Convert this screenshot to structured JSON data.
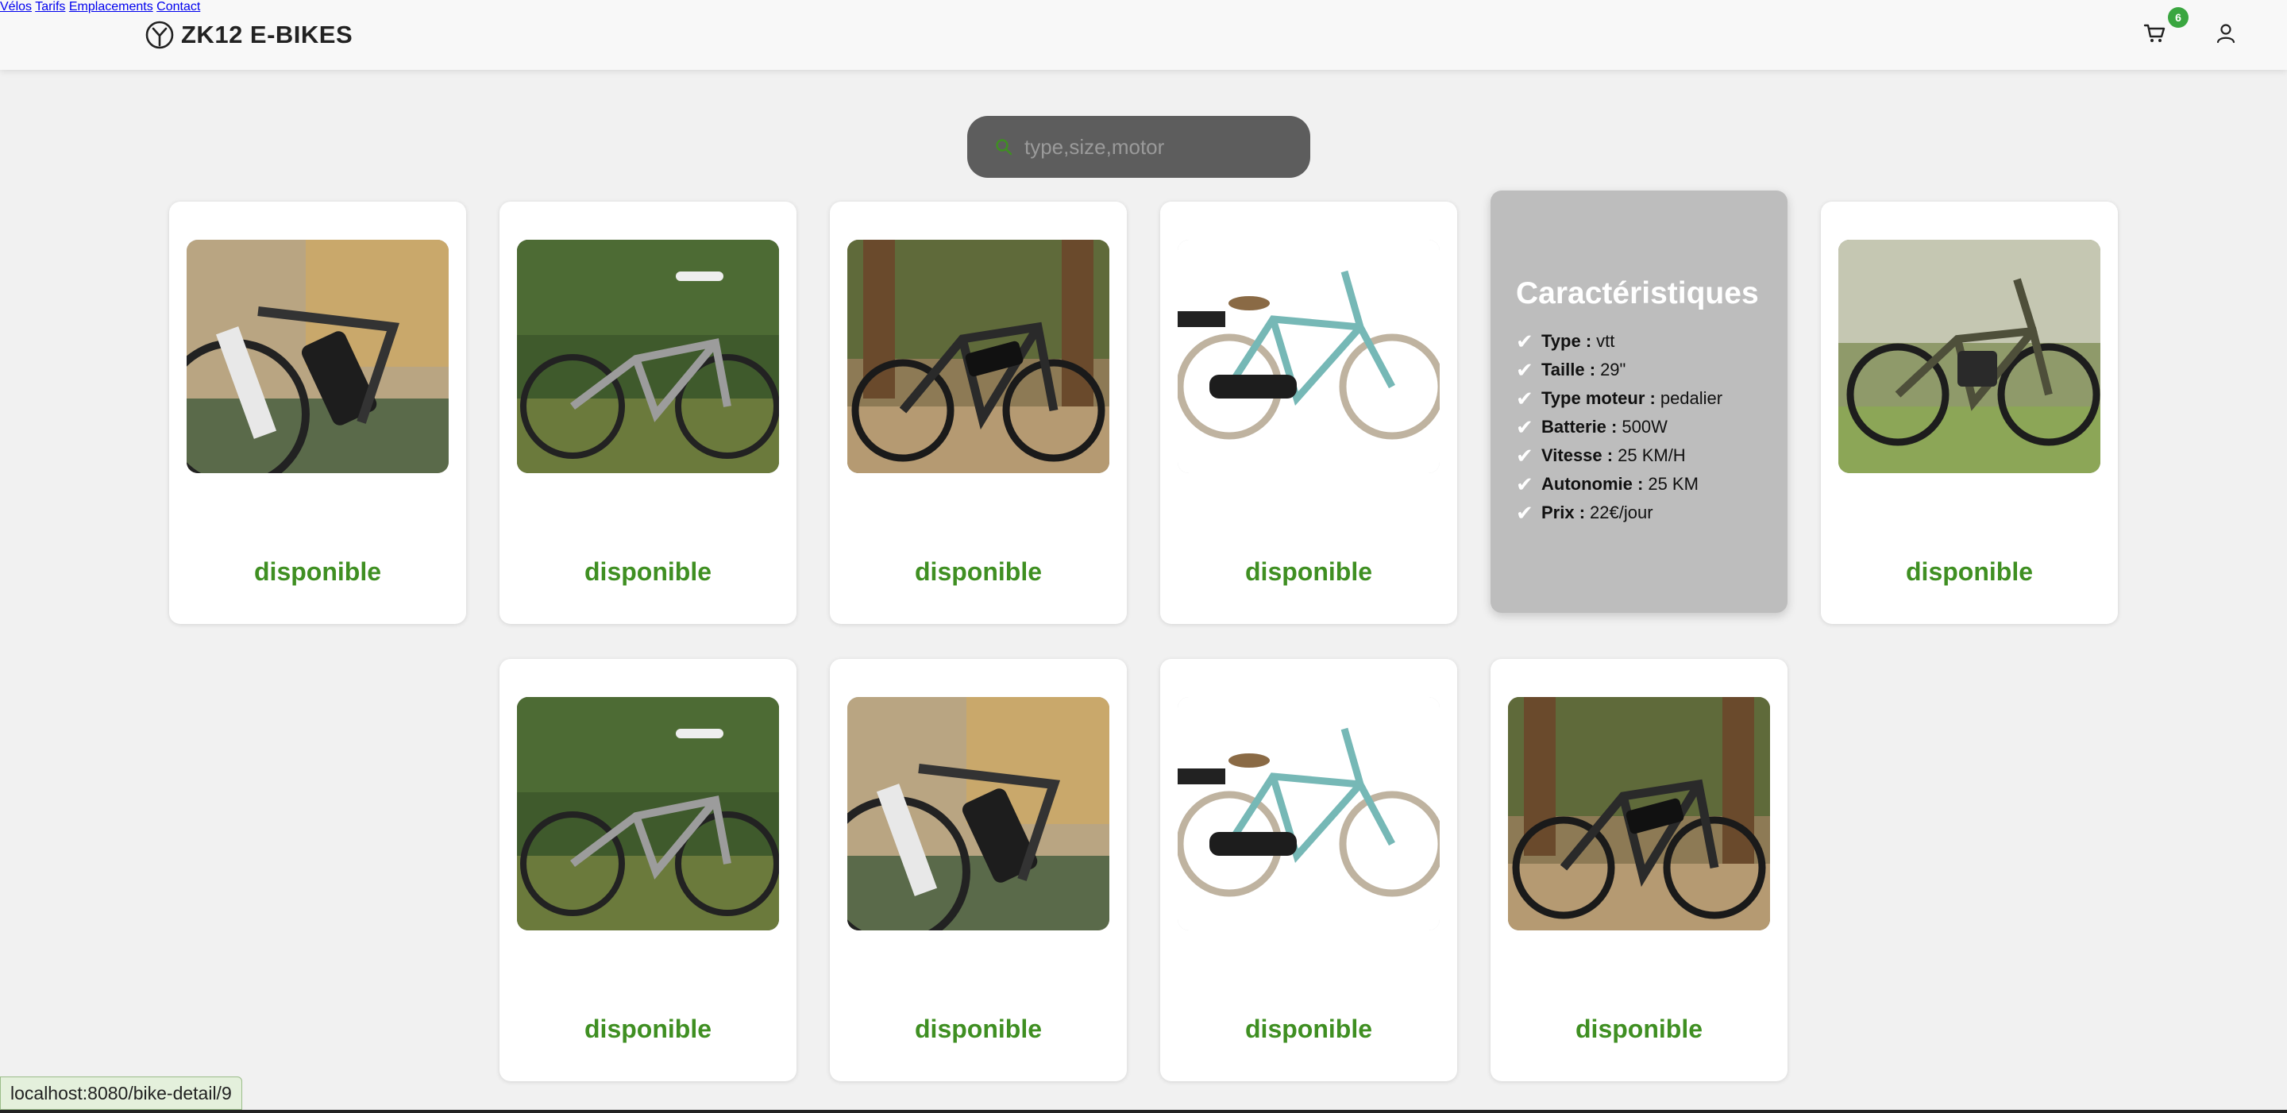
{
  "header": {
    "brand": "ZK12 E-BIKES",
    "nav": [
      "Vélos",
      "Tarifs",
      "Emplacements",
      "Contact"
    ],
    "cart_count": "6"
  },
  "search": {
    "placeholder": "type,size,motor"
  },
  "cards": [
    {
      "status": "disponible",
      "photo": "bike-photo-mtb-closeup"
    },
    {
      "status": "disponible",
      "photo": "bike-photo-full-suspension"
    },
    {
      "status": "disponible",
      "photo": "bike-photo-btwin-forest"
    },
    {
      "status": "disponible",
      "photo": "bike-photo-city-teal"
    },
    {
      "status": "disponible",
      "photo": "bike-photo-mtb-olive"
    },
    {
      "status": "disponible",
      "photo": "bike-photo-full-suspension"
    },
    {
      "status": "disponible",
      "photo": "bike-photo-mtb-closeup"
    },
    {
      "status": "disponible",
      "photo": "bike-photo-city-teal"
    },
    {
      "status": "disponible",
      "photo": "bike-photo-btwin-forest"
    }
  ],
  "specs": {
    "title": "Caractéristiques",
    "items": [
      {
        "label": "Type :",
        "value": "vtt"
      },
      {
        "label": "Taille :",
        "value": "29\""
      },
      {
        "label": "Type moteur :",
        "value": "pedalier"
      },
      {
        "label": "Batterie :",
        "value": "500W"
      },
      {
        "label": "Vitesse :",
        "value": "25 KM/H"
      },
      {
        "label": "Autonomie :",
        "value": "25 KM"
      },
      {
        "label": "Prix :",
        "value": "22€/jour"
      }
    ]
  },
  "statusbar": {
    "url": "localhost:8080/bike-detail/9"
  },
  "colors": {
    "available": "#3f8f22",
    "badge": "#3aa640",
    "search_bg": "#5d5d5d",
    "spec_card_bg": "#bdbdbd"
  }
}
